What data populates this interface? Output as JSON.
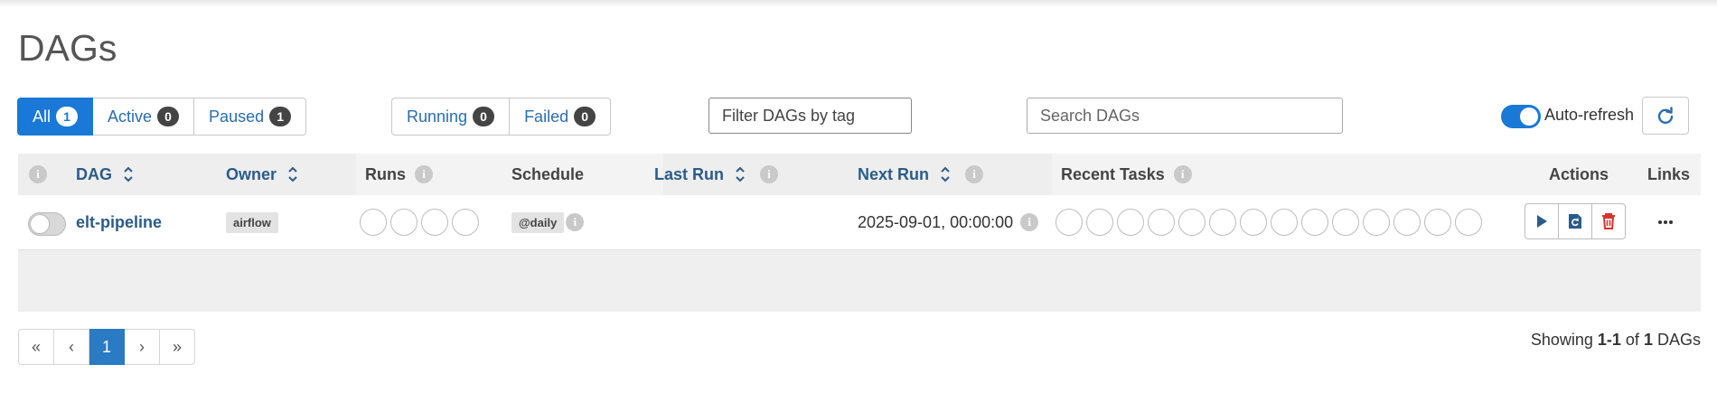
{
  "page_title": "DAGs",
  "status_filter": {
    "all": {
      "label": "All",
      "count": "1"
    },
    "active": {
      "label": "Active",
      "count": "0"
    },
    "paused": {
      "label": "Paused",
      "count": "1"
    }
  },
  "run_filter": {
    "running": {
      "label": "Running",
      "count": "0"
    },
    "failed": {
      "label": "Failed",
      "count": "0"
    }
  },
  "tag_filter": {
    "placeholder": "Filter DAGs by tag"
  },
  "search": {
    "placeholder": "Search DAGs"
  },
  "auto_refresh": {
    "label": "Auto-refresh",
    "enabled": true
  },
  "table": {
    "headers": {
      "dag": "DAG",
      "owner": "Owner",
      "runs": "Runs",
      "schedule": "Schedule",
      "last_run": "Last Run",
      "next_run": "Next Run",
      "recent_tasks": "Recent Tasks",
      "actions": "Actions",
      "links": "Links"
    },
    "rows": [
      {
        "paused": true,
        "dag_id": "elt-pipeline",
        "owner": "airflow",
        "schedule": "@daily",
        "last_run": "",
        "next_run": "2025-09-01, 00:00:00",
        "runs_circles": 4,
        "recent_task_circles": 14
      }
    ]
  },
  "pagination": {
    "first": "«",
    "prev": "‹",
    "current": "1",
    "next": "›",
    "last": "»"
  },
  "showing": {
    "prefix": "Showing",
    "range": "1-1",
    "of": "of",
    "total": "1",
    "suffix": "DAGs"
  },
  "colors": {
    "accent": "#1a79d6",
    "link": "#2a5c8a",
    "delete": "#d9342b"
  },
  "icons": [
    "info-icon",
    "sort-icon",
    "refresh-icon",
    "play-icon",
    "refresh-dag-icon",
    "trash-icon",
    "more-icon"
  ]
}
